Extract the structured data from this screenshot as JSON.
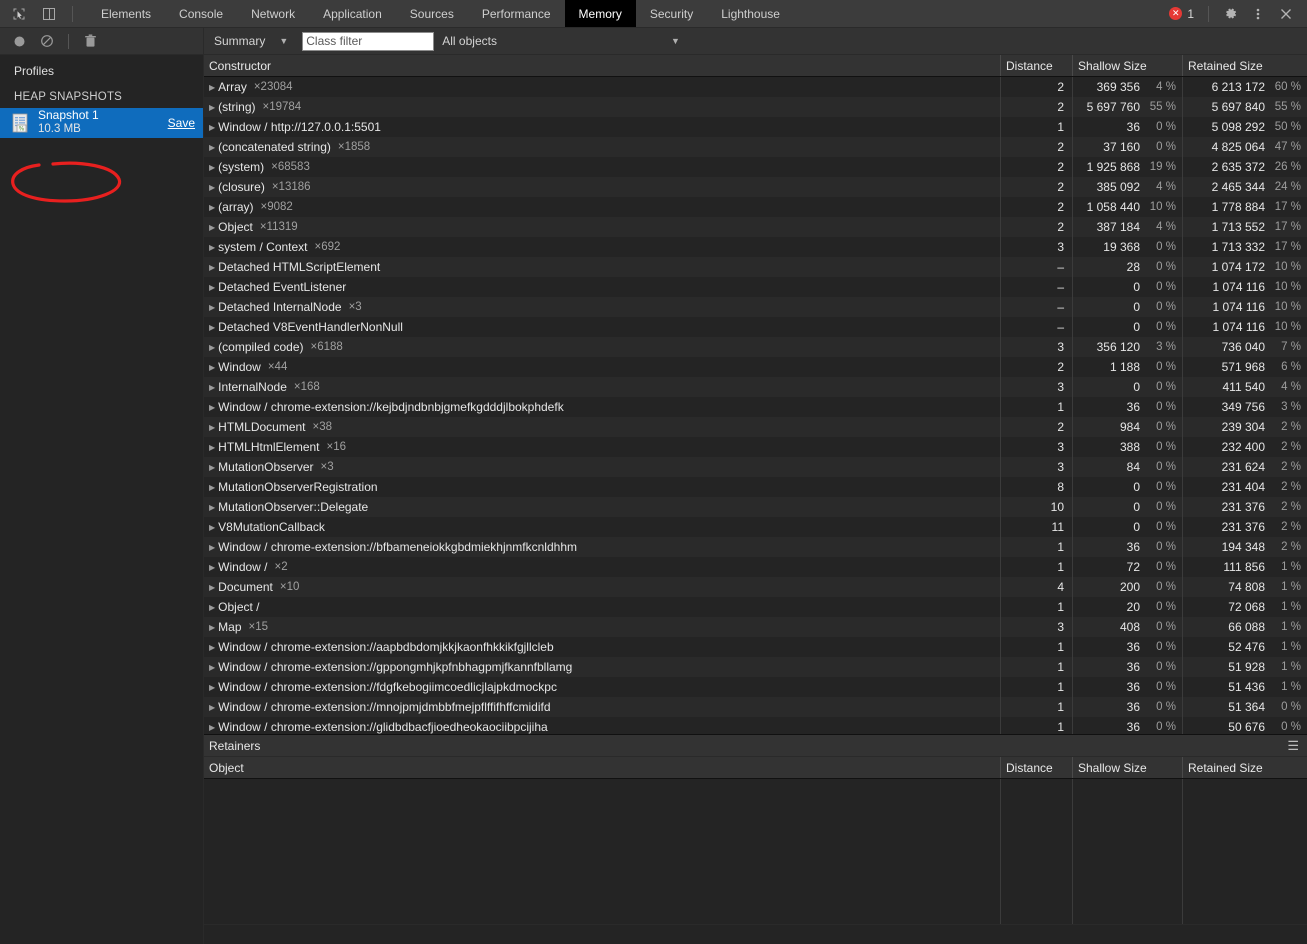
{
  "window": {
    "tabs": [
      {
        "label": "Elements",
        "active": false
      },
      {
        "label": "Console",
        "active": false
      },
      {
        "label": "Network",
        "active": false
      },
      {
        "label": "Application",
        "active": false
      },
      {
        "label": "Sources",
        "active": false
      },
      {
        "label": "Performance",
        "active": false
      },
      {
        "label": "Memory",
        "active": true
      },
      {
        "label": "Security",
        "active": false
      },
      {
        "label": "Lighthouse",
        "active": false
      }
    ],
    "error_count": "1",
    "error_glyph": "✕",
    "icons": {
      "inspect": "inspect-element-icon",
      "device": "device-toolbar-icon",
      "settings": "gear-icon",
      "more": "more-vertical-icon",
      "close": "close-icon"
    }
  },
  "toolbar": {
    "record_title": "record-icon",
    "clear_title": "clear-icon",
    "trash_title": "trash-icon",
    "view_select": "Summary",
    "caret": "▼",
    "class_filter_placeholder": "Class filter",
    "class_filter_value": "",
    "objects_select": "All objects"
  },
  "sidebar": {
    "title": "Profiles",
    "section": "HEAP SNAPSHOTS",
    "snapshot": {
      "name": "Snapshot 1",
      "size": "10.3 MB",
      "save_label": "Save"
    },
    "annotation_color": "#e8201f"
  },
  "table": {
    "columns": [
      "Constructor",
      "Distance",
      "Shallow Size",
      "Retained Size"
    ],
    "rows": [
      {
        "name": "Array",
        "count": "×23084",
        "distance": "2",
        "shallow": "369 356",
        "shallow_pct": "4 %",
        "retained": "6 213 172",
        "retained_pct": "60 %"
      },
      {
        "name": "(string)",
        "count": "×19784",
        "distance": "2",
        "shallow": "5 697 760",
        "shallow_pct": "55 %",
        "retained": "5 697 840",
        "retained_pct": "55 %"
      },
      {
        "name": "Window / http://127.0.0.1:5501",
        "count": "",
        "distance": "1",
        "shallow": "36",
        "shallow_pct": "0 %",
        "retained": "5 098 292",
        "retained_pct": "50 %"
      },
      {
        "name": "(concatenated string)",
        "count": "×1858",
        "distance": "2",
        "shallow": "37 160",
        "shallow_pct": "0 %",
        "retained": "4 825 064",
        "retained_pct": "47 %"
      },
      {
        "name": "(system)",
        "count": "×68583",
        "distance": "2",
        "shallow": "1 925 868",
        "shallow_pct": "19 %",
        "retained": "2 635 372",
        "retained_pct": "26 %"
      },
      {
        "name": "(closure)",
        "count": "×13186",
        "distance": "2",
        "shallow": "385 092",
        "shallow_pct": "4 %",
        "retained": "2 465 344",
        "retained_pct": "24 %"
      },
      {
        "name": "(array)",
        "count": "×9082",
        "distance": "2",
        "shallow": "1 058 440",
        "shallow_pct": "10 %",
        "retained": "1 778 884",
        "retained_pct": "17 %"
      },
      {
        "name": "Object",
        "count": "×11319",
        "distance": "2",
        "shallow": "387 184",
        "shallow_pct": "4 %",
        "retained": "1 713 552",
        "retained_pct": "17 %"
      },
      {
        "name": "system / Context",
        "count": "×692",
        "distance": "3",
        "shallow": "19 368",
        "shallow_pct": "0 %",
        "retained": "1 713 332",
        "retained_pct": "17 %"
      },
      {
        "name": "Detached HTMLScriptElement",
        "count": "",
        "distance": "–",
        "shallow": "28",
        "shallow_pct": "0 %",
        "retained": "1 074 172",
        "retained_pct": "10 %"
      },
      {
        "name": "Detached EventListener",
        "count": "",
        "distance": "–",
        "shallow": "0",
        "shallow_pct": "0 %",
        "retained": "1 074 116",
        "retained_pct": "10 %"
      },
      {
        "name": "Detached InternalNode",
        "count": "×3",
        "distance": "–",
        "shallow": "0",
        "shallow_pct": "0 %",
        "retained": "1 074 116",
        "retained_pct": "10 %"
      },
      {
        "name": "Detached V8EventHandlerNonNull",
        "count": "",
        "distance": "–",
        "shallow": "0",
        "shallow_pct": "0 %",
        "retained": "1 074 116",
        "retained_pct": "10 %"
      },
      {
        "name": "(compiled code)",
        "count": "×6188",
        "distance": "3",
        "shallow": "356 120",
        "shallow_pct": "3 %",
        "retained": "736 040",
        "retained_pct": "7 %"
      },
      {
        "name": "Window",
        "count": "×44",
        "distance": "2",
        "shallow": "1 188",
        "shallow_pct": "0 %",
        "retained": "571 968",
        "retained_pct": "6 %"
      },
      {
        "name": "InternalNode",
        "count": "×168",
        "distance": "3",
        "shallow": "0",
        "shallow_pct": "0 %",
        "retained": "411 540",
        "retained_pct": "4 %"
      },
      {
        "name": "Window / chrome-extension://kejbdjndbnbjgmefkgdddjlbokphdefk",
        "count": "",
        "distance": "1",
        "shallow": "36",
        "shallow_pct": "0 %",
        "retained": "349 756",
        "retained_pct": "3 %"
      },
      {
        "name": "HTMLDocument",
        "count": "×38",
        "distance": "2",
        "shallow": "984",
        "shallow_pct": "0 %",
        "retained": "239 304",
        "retained_pct": "2 %"
      },
      {
        "name": "HTMLHtmlElement",
        "count": "×16",
        "distance": "3",
        "shallow": "388",
        "shallow_pct": "0 %",
        "retained": "232 400",
        "retained_pct": "2 %"
      },
      {
        "name": "MutationObserver",
        "count": "×3",
        "distance": "3",
        "shallow": "84",
        "shallow_pct": "0 %",
        "retained": "231 624",
        "retained_pct": "2 %"
      },
      {
        "name": "MutationObserverRegistration",
        "count": "",
        "distance": "8",
        "shallow": "0",
        "shallow_pct": "0 %",
        "retained": "231 404",
        "retained_pct": "2 %"
      },
      {
        "name": "MutationObserver::Delegate",
        "count": "",
        "distance": "10",
        "shallow": "0",
        "shallow_pct": "0 %",
        "retained": "231 376",
        "retained_pct": "2 %"
      },
      {
        "name": "V8MutationCallback",
        "count": "",
        "distance": "11",
        "shallow": "0",
        "shallow_pct": "0 %",
        "retained": "231 376",
        "retained_pct": "2 %"
      },
      {
        "name": "Window / chrome-extension://bfbameneiokkgbdmiekhjnmfkcnldhhm",
        "count": "",
        "distance": "1",
        "shallow": "36",
        "shallow_pct": "0 %",
        "retained": "194 348",
        "retained_pct": "2 %"
      },
      {
        "name": "Window /",
        "count": "×2",
        "distance": "1",
        "shallow": "72",
        "shallow_pct": "0 %",
        "retained": "111 856",
        "retained_pct": "1 %"
      },
      {
        "name": "Document",
        "count": "×10",
        "distance": "4",
        "shallow": "200",
        "shallow_pct": "0 %",
        "retained": "74 808",
        "retained_pct": "1 %"
      },
      {
        "name": "Object /",
        "count": "",
        "distance": "1",
        "shallow": "20",
        "shallow_pct": "0 %",
        "retained": "72 068",
        "retained_pct": "1 %"
      },
      {
        "name": "Map",
        "count": "×15",
        "distance": "3",
        "shallow": "408",
        "shallow_pct": "0 %",
        "retained": "66 088",
        "retained_pct": "1 %"
      },
      {
        "name": "Window / chrome-extension://aapbdbdomjkkjkaonfhkkikfgjllcleb",
        "count": "",
        "distance": "1",
        "shallow": "36",
        "shallow_pct": "0 %",
        "retained": "52 476",
        "retained_pct": "1 %"
      },
      {
        "name": "Window / chrome-extension://gppongmhjkpfnbhagpmjfkannfbllamg",
        "count": "",
        "distance": "1",
        "shallow": "36",
        "shallow_pct": "0 %",
        "retained": "51 928",
        "retained_pct": "1 %"
      },
      {
        "name": "Window / chrome-extension://fdgfkebogiimcoedlicjlajpkdmockpc",
        "count": "",
        "distance": "1",
        "shallow": "36",
        "shallow_pct": "0 %",
        "retained": "51 436",
        "retained_pct": "1 %"
      },
      {
        "name": "Window / chrome-extension://mnojpmjdmbbfmejpflffifhffcmidifd",
        "count": "",
        "distance": "1",
        "shallow": "36",
        "shallow_pct": "0 %",
        "retained": "51 364",
        "retained_pct": "0 %"
      },
      {
        "name": "Window / chrome-extension://glidbdbacfjioedheokaociibpcijiha",
        "count": "",
        "distance": "1",
        "shallow": "36",
        "shallow_pct": "0 %",
        "retained": "50 676",
        "retained_pct": "0 %"
      }
    ]
  },
  "retainers": {
    "title": "Retainers",
    "menu_glyph": "☰",
    "columns": [
      "Object",
      "Distance",
      "Shallow Size",
      "Retained Size"
    ],
    "rows": []
  }
}
